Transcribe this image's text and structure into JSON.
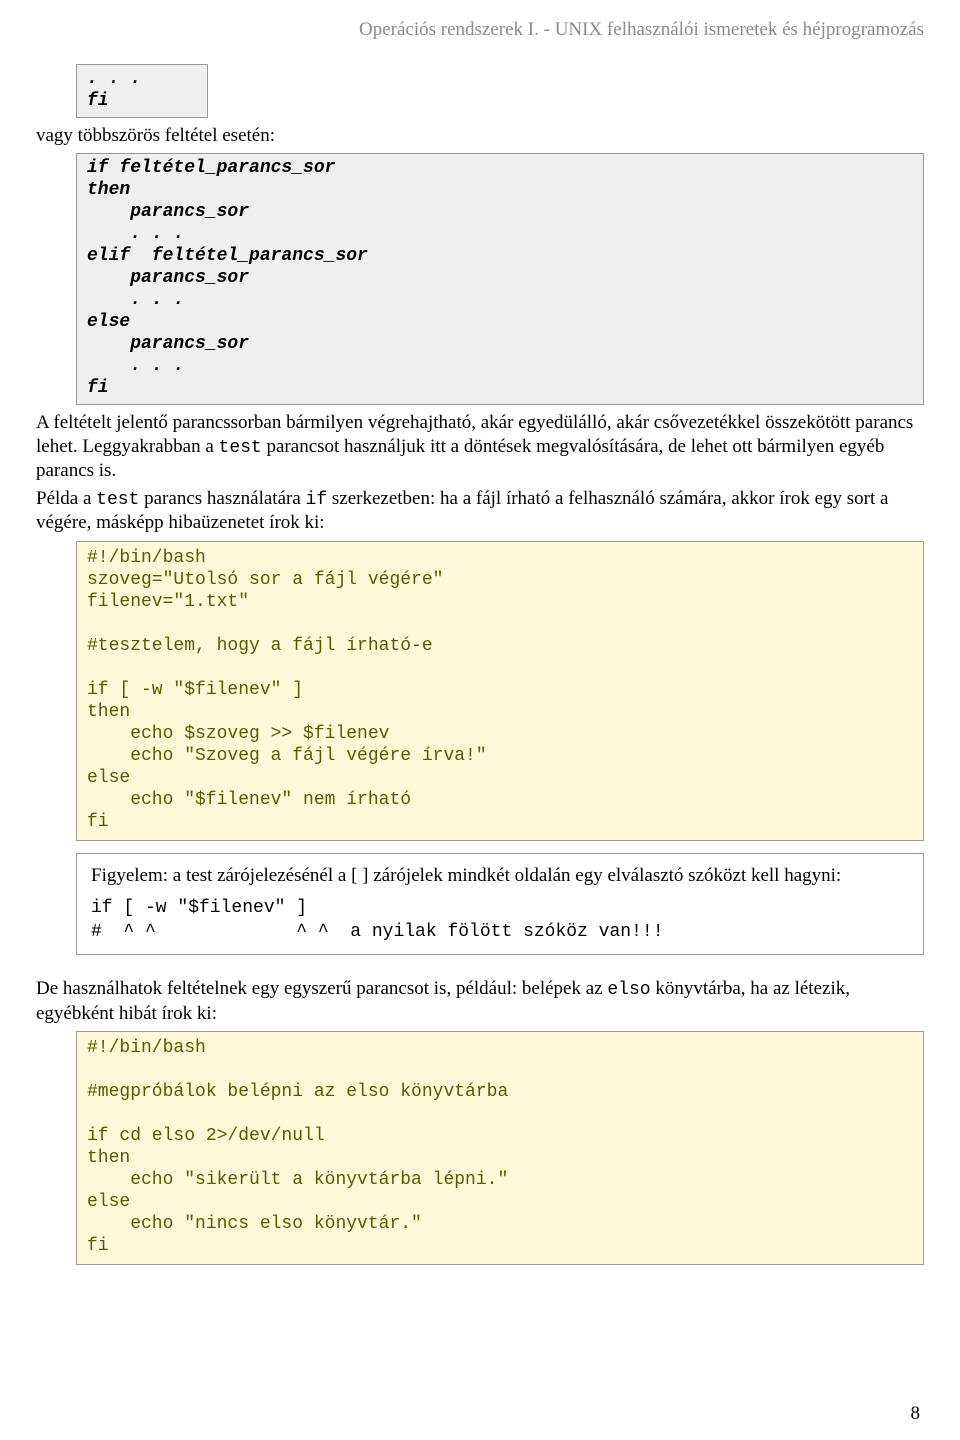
{
  "header": "Operációs rendszerek I. - UNIX felhasználói ismeretek és héjprogramozás",
  "code0": ". . .\nfi",
  "p1_a": "vagy többszörös feltétel esetén:",
  "code1": "if feltétel_parancs_sor\nthen\n    parancs_sor\n    . . .\nelif  feltétel_parancs_sor\n    parancs_sor\n    . . .\nelse\n    parancs_sor\n    . . .\nfi",
  "p2_a": "A feltételt jelentő parancssorban bármilyen végrehajtható, akár egyedülálló, akár csővezetékkel összekötött parancs lehet. Leggyakrabban a ",
  "p2_b": "test",
  "p2_c": " parancsot használjuk itt a döntések megvalósítására, de lehet ott bármilyen egyéb parancs is.",
  "p3_a": "Példa a ",
  "p3_b": "test",
  "p3_c": " parancs használatára ",
  "p3_d": "if",
  "p3_e": " szerkezetben: ha a fájl írható a felhasználó számára, akkor írok egy sort a végére, másképp hibaüzenetet írok ki:",
  "code2": "#!/bin/bash\nszoveg=\"Utolsó sor a fájl végére\"\nfilenev=\"1.txt\"\n\n#tesztelem, hogy a fájl írható-e\n\nif [ -w \"$filenev\" ]\nthen\n    echo $szoveg >> $filenev\n    echo \"Szoveg a fájl végére írva!\"\nelse\n    echo \"$filenev\" nem írható\nfi",
  "note_text": "Figyelem: a test zárójelezésénél a [ ] zárójelek mindkét oldalán egy elválasztó szóközt kell hagyni:",
  "note_code": "if [ -w \"$filenev\" ]\n#  ^ ^             ^ ^  a nyilak fölött szóköz van!!!",
  "p4_a": "De használhatok feltételnek egy egyszerű parancsot is, például: belépek az ",
  "p4_b": "elso",
  "p4_c": " könyvtárba, ha az létezik, egyébként hibát írok ki:",
  "code3": "#!/bin/bash\n\n#megpróbálok belépni az elso könyvtárba\n\nif cd elso 2>/dev/null\nthen\n    echo \"sikerült a könyvtárba lépni.\"\nelse\n    echo \"nincs elso könyvtár.\"\nfi",
  "page_number": "8"
}
